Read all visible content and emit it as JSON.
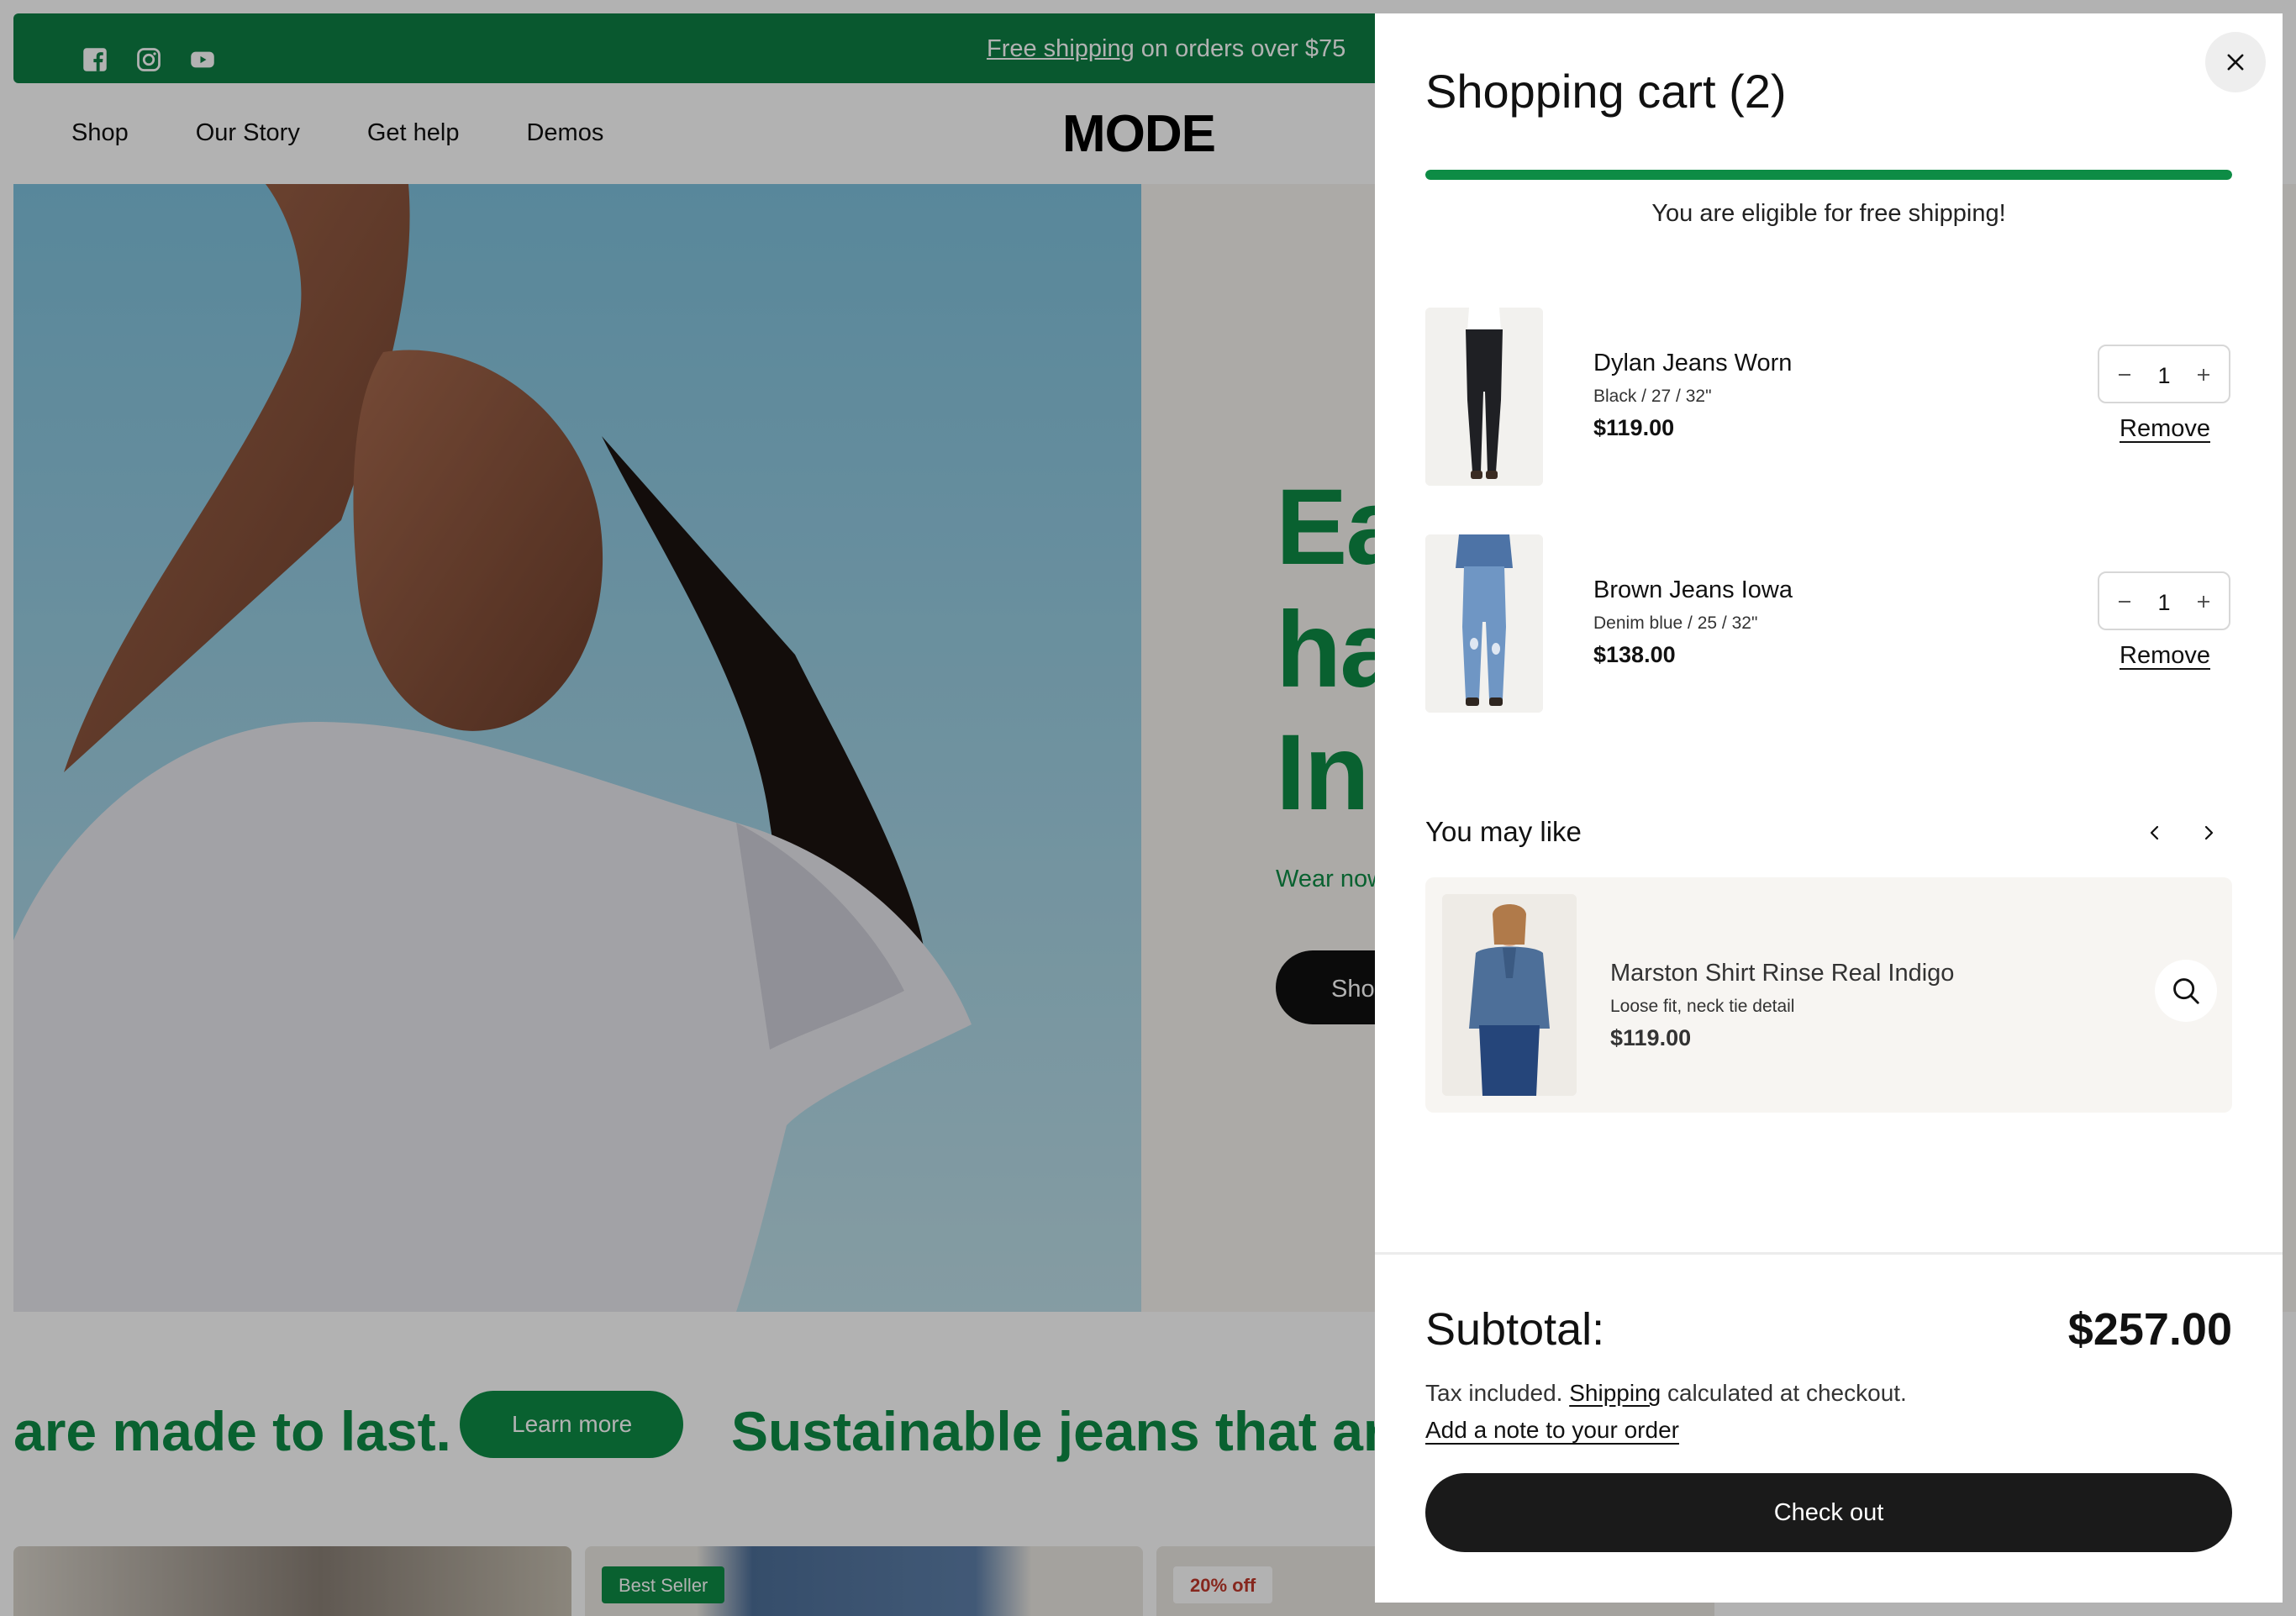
{
  "announcement": {
    "link_text": "Free shipping",
    "rest_text": " on orders over $75",
    "social_icons": [
      "facebook-icon",
      "instagram-icon",
      "youtube-icon"
    ]
  },
  "nav": {
    "items": [
      "Shop",
      "Our Story",
      "Get help",
      "Demos"
    ],
    "logo": "MODE"
  },
  "hero": {
    "heading_lines": [
      "Ea",
      "ha",
      "In"
    ],
    "subtext": "Wear now",
    "button_label": "Sho"
  },
  "marquee": {
    "text1": "are made to last.",
    "button_label": "Learn more",
    "text2": "Sustainable jeans that are"
  },
  "product_badges": [
    "Best Seller",
    "20% off"
  ],
  "cart": {
    "title": "Shopping cart (2)",
    "free_shipping_progress": 1.0,
    "free_shipping_message": "You are eligible for free shipping!",
    "items": [
      {
        "name": "Dylan Jeans Worn",
        "variant": "Black / 27 / 32\"",
        "price": "$119.00",
        "quantity": "1",
        "remove_label": "Remove"
      },
      {
        "name": "Brown Jeans Iowa",
        "variant": "Denim blue / 25 / 32\"",
        "price": "$138.00",
        "quantity": "1",
        "remove_label": "Remove"
      }
    ],
    "recommendations": {
      "title": "You may like",
      "items": [
        {
          "name": "Marston Shirt Rinse Real Indigo",
          "description": "Loose fit, neck tie detail",
          "price": "$119.00"
        }
      ]
    },
    "subtotal_label": "Subtotal:",
    "subtotal_value": "$257.00",
    "tax_prefix": "Tax included. ",
    "tax_link": "Shipping",
    "tax_suffix": " calculated at checkout.",
    "note_link": "Add a note to your order",
    "checkout_label": "Check out"
  },
  "colors": {
    "brand_green": "#0d8c45",
    "announcement_green": "#0d7f44",
    "checkout_black": "#1a1a1a"
  }
}
